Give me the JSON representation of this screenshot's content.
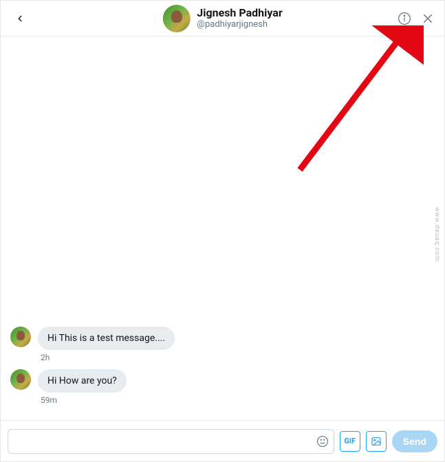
{
  "header": {
    "user_name": "Jignesh Padhiyar",
    "user_handle": "@padhiyarjignesh"
  },
  "messages": [
    {
      "text": "Hi This is a test message....",
      "time": "2h"
    },
    {
      "text": "Hi How are you?",
      "time": "59m"
    }
  ],
  "composer": {
    "placeholder": "",
    "gif_label": "GIF",
    "send_label": "Send"
  },
  "watermark": "www.deuaq.com",
  "annotation": {
    "arrow_color": "#e30613"
  }
}
